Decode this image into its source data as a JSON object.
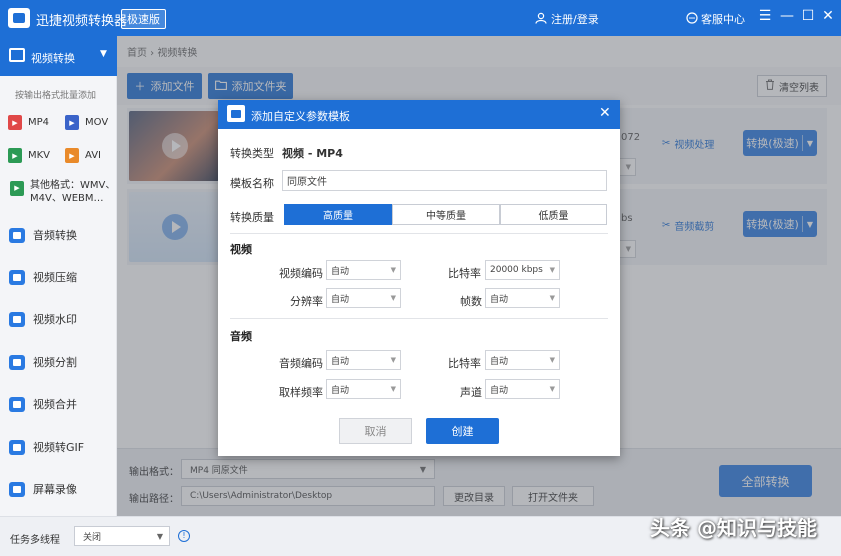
{
  "app": {
    "title": "迅捷视频转换器",
    "edition": "极速版",
    "login": "注册/登录",
    "service": "客服中心",
    "window_buttons": [
      "☰",
      "—",
      "☐",
      "✕"
    ]
  },
  "sidebar": {
    "active_item": "视频转换",
    "hint": "按输出格式批量添加",
    "formats": [
      "MP4",
      "MOV",
      "MKV",
      "AVI"
    ],
    "other_formats": [
      "其他格式：WMV、",
      "M4V、WEBM…"
    ],
    "items": [
      "音频转换",
      "视频压缩",
      "视频水印",
      "视频分割",
      "视频合并",
      "视频转GIF",
      "屏幕录像"
    ]
  },
  "main": {
    "breadcrumb": "首页 › 视频转换",
    "add_file": "添加文件",
    "add_folder": "添加文件夹",
    "clear_list": "清空列表",
    "rows": [
      {
        "fragment": "072",
        "link": "视频处理",
        "convert": "转换(极速)"
      },
      {
        "fragment": "bs",
        "link": "音频截剪",
        "convert": "转换(极速)"
      }
    ]
  },
  "bottom": {
    "output_format_label": "输出格式：",
    "output_format_value": "MP4  同原文件",
    "output_path_label": "输出路径：",
    "output_path_value": "C:\\Users\\Administrator\\Desktop",
    "change_dir": "更改目录",
    "open_folder": "打开文件夹",
    "convert_all": "全部转换",
    "multithread_label": "任务多线程",
    "multithread_value": "关闭",
    "watermark": "头条 @知识与技能"
  },
  "dialog": {
    "title": "添加自定义参数模板",
    "convert_type_label": "转换类型",
    "convert_type_value": "视频 - MP4",
    "template_name_label": "模板名称",
    "template_name_value": "同原文件",
    "quality_label": "转换质量",
    "quality_options": [
      "高质量",
      "中等质量",
      "低质量"
    ],
    "video_section": "视频",
    "video_codec_label": "视频编码",
    "video_codec_value": "自动",
    "video_bitrate_label": "比特率",
    "video_bitrate_value": "20000 kbps",
    "resolution_label": "分辨率",
    "resolution_value": "自动",
    "fps_label": "帧数",
    "fps_value": "自动",
    "audio_section": "音频",
    "audio_codec_label": "音频编码",
    "audio_codec_value": "自动",
    "audio_bitrate_label": "比特率",
    "audio_bitrate_value": "自动",
    "sample_rate_label": "取样频率",
    "sample_rate_value": "自动",
    "channel_label": "声道",
    "channel_value": "自动",
    "cancel": "取消",
    "create": "创建"
  },
  "colors": {
    "primary": "#1e6fd6",
    "button": "#2a7ae2",
    "sidebar_bg": "#f4f5f8"
  }
}
